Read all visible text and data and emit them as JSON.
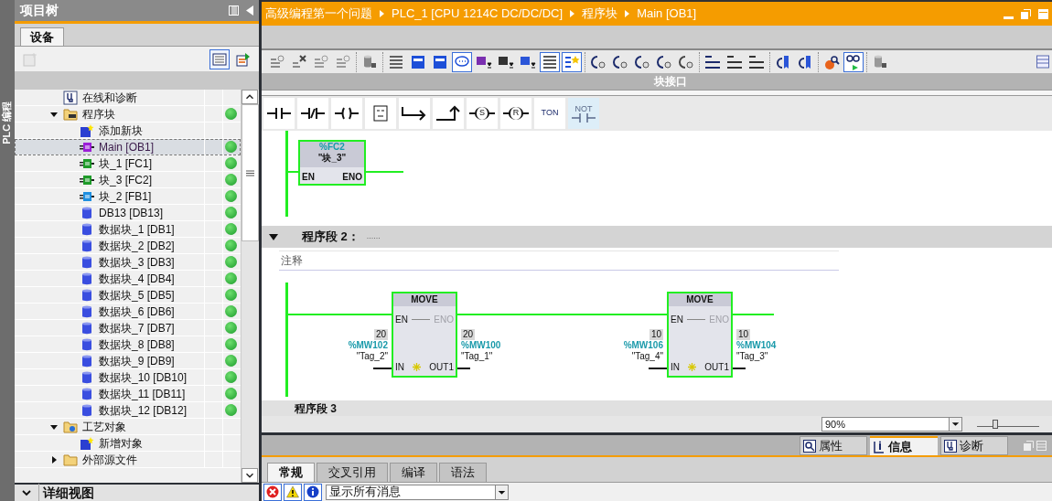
{
  "side_strip": {
    "label": "PLC 编程"
  },
  "project_tree": {
    "title": "项目树",
    "tabs": [
      {
        "label": "设备",
        "selected": true
      }
    ],
    "tool_buttons": [
      {
        "kind": "new",
        "disabled": true,
        "selected": false
      },
      {
        "kind": "list-view",
        "disabled": false,
        "selected": true
      },
      {
        "kind": "export",
        "disabled": false,
        "selected": false
      }
    ],
    "items": [
      {
        "label": "在线和诊断",
        "kind": "diagnostics",
        "ok": false,
        "selected": false
      },
      {
        "label": "程序块",
        "kind": "folder-blocks",
        "expanded": true,
        "ok": true,
        "selected": false,
        "children": [
          {
            "label": "添加新块",
            "kind": "add-new",
            "ok": false,
            "selected": false
          },
          {
            "label": "Main [OB1]",
            "kind": "ob",
            "ok": true,
            "selected": true
          },
          {
            "label": "块_1 [FC1]",
            "kind": "fc",
            "ok": true,
            "selected": false
          },
          {
            "label": "块_3 [FC2]",
            "kind": "fc",
            "ok": true,
            "selected": false
          },
          {
            "label": "块_2 [FB1]",
            "kind": "fb",
            "ok": true,
            "selected": false
          },
          {
            "label": "DB13 [DB13]",
            "kind": "db",
            "ok": true,
            "selected": false
          },
          {
            "label": "数据块_1 [DB1]",
            "kind": "db",
            "ok": true,
            "selected": false
          },
          {
            "label": "数据块_2 [DB2]",
            "kind": "db",
            "ok": true,
            "selected": false
          },
          {
            "label": "数据块_3 [DB3]",
            "kind": "db",
            "ok": true,
            "selected": false
          },
          {
            "label": "数据块_4 [DB4]",
            "kind": "db",
            "ok": true,
            "selected": false
          },
          {
            "label": "数据块_5 [DB5]",
            "kind": "db",
            "ok": true,
            "selected": false
          },
          {
            "label": "数据块_6 [DB6]",
            "kind": "db",
            "ok": true,
            "selected": false
          },
          {
            "label": "数据块_7 [DB7]",
            "kind": "db",
            "ok": true,
            "selected": false
          },
          {
            "label": "数据块_8 [DB8]",
            "kind": "db",
            "ok": true,
            "selected": false
          },
          {
            "label": "数据块_9 [DB9]",
            "kind": "db",
            "ok": true,
            "selected": false
          },
          {
            "label": "数据块_10 [DB10]",
            "kind": "db",
            "ok": true,
            "selected": false
          },
          {
            "label": "数据块_11 [DB11]",
            "kind": "db",
            "ok": true,
            "selected": false
          },
          {
            "label": "数据块_12 [DB12]",
            "kind": "db",
            "ok": true,
            "selected": false
          }
        ]
      },
      {
        "label": "工艺对象",
        "kind": "folder-tech",
        "expanded": true,
        "ok": false,
        "selected": false,
        "children": [
          {
            "label": "新增对象",
            "kind": "add-new",
            "ok": false,
            "selected": false
          }
        ]
      },
      {
        "label": "外部源文件",
        "kind": "folder",
        "expanded": false,
        "ok": false,
        "selected": false
      }
    ],
    "detail_view": {
      "label": "详细视图",
      "expanded": false
    }
  },
  "editor": {
    "breadcrumb": [
      "高级编程第一个问题",
      "PLC_1 [CPU 1214C DC/DC/DC]",
      "程序块",
      "Main [OB1]"
    ],
    "toolbar": [
      [
        {
          "kind": "net-insert",
          "selected": false
        },
        {
          "kind": "net-delete",
          "selected": false
        },
        {
          "kind": "row-insert",
          "selected": false
        },
        {
          "kind": "row-add",
          "selected": false
        }
      ],
      [
        {
          "kind": "db-undo",
          "selected": false
        }
      ],
      [
        {
          "kind": "lines",
          "selected": false
        },
        {
          "kind": "panel-a",
          "selected": false
        },
        {
          "kind": "panel-b",
          "selected": false
        },
        {
          "kind": "comment",
          "selected": true
        },
        {
          "kind": "tag-down",
          "selected": false
        },
        {
          "kind": "callout-down",
          "selected": false
        },
        {
          "kind": "net-down",
          "selected": false
        },
        {
          "kind": "list",
          "selected": true
        },
        {
          "kind": "star-list",
          "selected": true
        }
      ],
      [
        {
          "kind": "call-a",
          "selected": false
        },
        {
          "kind": "call-b",
          "selected": false
        },
        {
          "kind": "call-c",
          "selected": false
        },
        {
          "kind": "call-d",
          "selected": false
        },
        {
          "kind": "call-e",
          "selected": false
        }
      ],
      [
        {
          "kind": "jump-a",
          "selected": false
        },
        {
          "kind": "jump-b",
          "selected": false
        },
        {
          "kind": "jump-c",
          "selected": false
        }
      ],
      [
        {
          "kind": "bookmark-prev",
          "selected": false
        },
        {
          "kind": "bookmark-next",
          "selected": false
        }
      ],
      [
        {
          "kind": "monitor-search",
          "selected": false
        },
        {
          "kind": "glasses",
          "selected": true
        }
      ],
      [
        {
          "kind": "db-lock",
          "selected": false
        }
      ]
    ],
    "interface_bar": {
      "label": "块接口"
    },
    "palette": [
      {
        "kind": "contact"
      },
      {
        "kind": "nc-contact"
      },
      {
        "kind": "coil"
      },
      {
        "kind": "empty-box"
      },
      {
        "kind": "open-branch"
      },
      {
        "kind": "close-branch"
      },
      {
        "kind": "set-coil",
        "label": "S"
      },
      {
        "kind": "reset-coil",
        "label": "R"
      },
      {
        "kind": "text",
        "label": "TON"
      },
      {
        "kind": "not",
        "label": "NOT"
      }
    ],
    "network_1": {
      "block": {
        "address": "%FC2",
        "name": "\"块_3\"",
        "en": "EN",
        "eno": "ENO"
      }
    },
    "network_2": {
      "title": "程序段 2：",
      "dots": "......",
      "comment": "注释",
      "boxes": [
        {
          "name": "MOVE",
          "en": "EN",
          "eno": "ENO",
          "in_pin": "IN",
          "out_pin": "OUT1",
          "in_value": "20",
          "in_address": "%MW102",
          "in_tag": "\"Tag_2\"",
          "out_value": "20",
          "out_address": "%MW100",
          "out_tag": "\"Tag_1\""
        },
        {
          "name": "MOVE",
          "en": "EN",
          "eno": "ENO",
          "in_pin": "IN",
          "out_pin": "OUT1",
          "in_value": "10",
          "in_address": "%MW106",
          "in_tag": "\"Tag_4\"",
          "out_value": "10",
          "out_address": "%MW104",
          "out_tag": "\"Tag_3\""
        }
      ]
    },
    "network_3": {
      "title": "程序段 3"
    },
    "zoom": {
      "value": "90%",
      "level": 0.3
    }
  },
  "inspector": {
    "tabs": [
      {
        "label": "属性",
        "kind": "properties",
        "selected": false
      },
      {
        "label": "信息",
        "kind": "info",
        "selected": true
      },
      {
        "label": "诊断",
        "kind": "diagnostics",
        "selected": false
      }
    ],
    "subtabs": [
      {
        "label": "常规",
        "selected": true
      },
      {
        "label": "交叉引用",
        "selected": false
      },
      {
        "label": "编译",
        "selected": false
      },
      {
        "label": "语法",
        "selected": false
      }
    ],
    "filters": [
      {
        "kind": "error",
        "selected": true
      },
      {
        "kind": "warning",
        "selected": true
      },
      {
        "kind": "info",
        "selected": true
      }
    ],
    "message_filter": {
      "value": "显示所有消息"
    }
  }
}
